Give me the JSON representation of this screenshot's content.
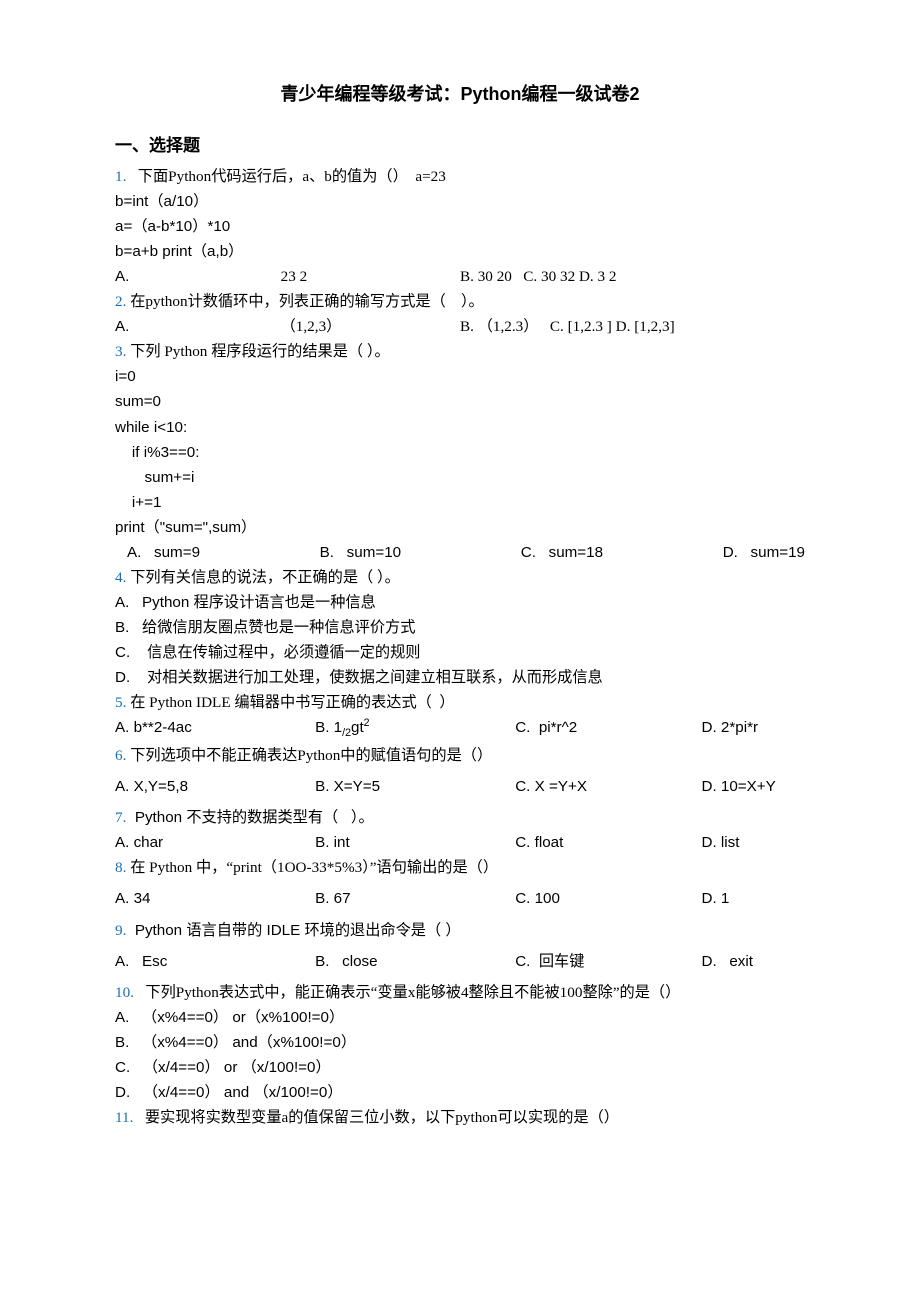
{
  "title": "青少年编程等级考试：Python编程一级试卷2",
  "section": "一、选择题",
  "q1": {
    "num": "1.",
    "text": "   下面Python代码运行后，a、b的值为（）  a=23",
    "c1": "b=int（a/10）",
    "c2": "a=（a-b*10）*10",
    "c3": "b=a+b print（a,b）",
    "optA_label": "A.",
    "optA_val": "23 2",
    "optRest": "B. 30 20   C. 30 32 D. 3 2"
  },
  "q2": {
    "num": "2.",
    "text": " 在python计数循环中，列表正确的输写方式是（    ）。",
    "optA_label": "A.",
    "optA_val": "（1,2,3）",
    "optRest": "B. （1,2.3）   C. [1,2.3 ] D. [1,2,3]"
  },
  "q3": {
    "num": "3.",
    "text": " 下列 Python 程序段运行的结果是（ ）。",
    "c1": "i=0",
    "c2": "sum=0",
    "c3": "while i<10:",
    "c4": "    if i%3==0:",
    "c5": "       sum+=i",
    "c6": "    i+=1",
    "c7": "print（\"sum=\",sum）",
    "optA": "A.   sum=9",
    "optB": "B.   sum=10",
    "optC": "C.   sum=18",
    "optD": "D.   sum=19"
  },
  "q4": {
    "num": "4.",
    "text": " 下列有关信息的说法，不正确的是（ ）。",
    "a": "A.   Python 程序设计语言也是一种信息",
    "b": "B.   给微信朋友圈点赞也是一种信息评价方式",
    "c": "C.    信息在传输过程中，必须遵循一定的规则",
    "d": "D.    对相关数据进行加工处理，使数据之间建立相互联系，从而形成信息"
  },
  "q5": {
    "num": "5.",
    "text": " 在 Python IDLE 编辑器中书写正确的表达式（  ）",
    "optA": "A. b**2-4ac",
    "optB_pre": "B. 1",
    "optB_sub": "/2",
    "optB_mid": "gt",
    "optB_sup": "2",
    "optC": "C.  pi*r^2",
    "optD": "D. 2*pi*r"
  },
  "q6": {
    "num": "6.",
    "text": " 下列选项中不能正确表达Python中的赋值语句的是（）",
    "optA": "A. X,Y=5,8",
    "optB": "B. X=Y=5",
    "optC": "C. X =Y+X",
    "optD": "D. 10=X+Y"
  },
  "q7": {
    "num": "7.",
    "text": "  Python 不支持的数据类型有（   ）。",
    "optA": "A. char",
    "optB": "B. int",
    "optC": "C. float",
    "optD": "D. list"
  },
  "q8": {
    "num": "8.",
    "text": " 在 Python 中，“print（1OO-33*5%3）”语句输出的是（）",
    "optA": "A. 34",
    "optB": "B. 67",
    "optC": "C. 100",
    "optD": "D. 1"
  },
  "q9": {
    "num": "9.",
    "text": "  Python 语言自带的 IDLE 环境的退出命令是（ ）",
    "optA": "A.   Esc",
    "optB": "B.   close",
    "optC": "C.  回车键",
    "optD": "D.   exit"
  },
  "q10": {
    "num": "10.",
    "text": "   下列Python表达式中，能正确表示“变量x能够被4整除且不能被100整除”的是（）",
    "a": "A.   （x%4==0） or（x%100!=0）",
    "b": "B.   （x%4==0） and（x%100!=0）",
    "c": "C.   （x/4==0） or （x/100!=0）",
    "d": "D.   （x/4==0） and （x/100!=0）"
  },
  "q11": {
    "num": "11.",
    "text": "   要实现将实数型变量a的值保留三位小数，以下python可以实现的是（）"
  }
}
